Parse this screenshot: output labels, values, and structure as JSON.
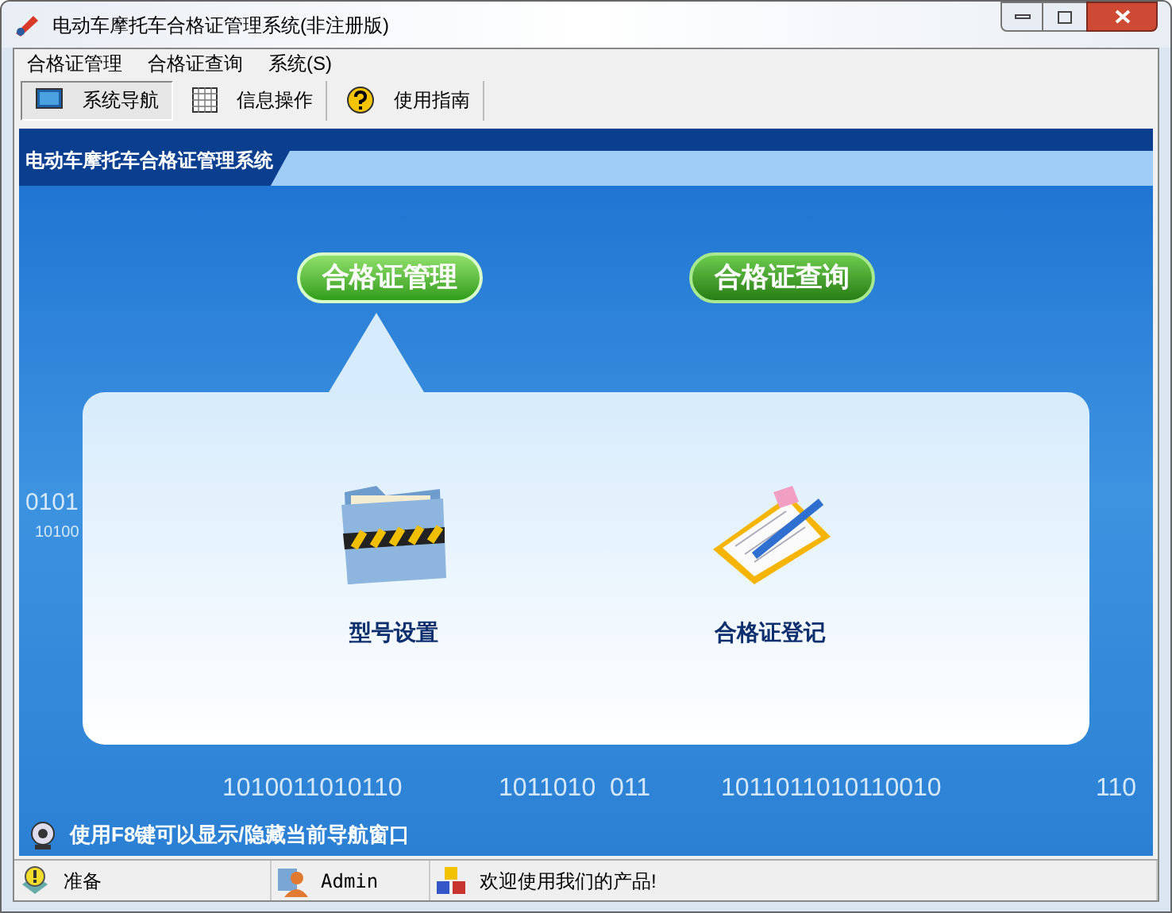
{
  "window": {
    "title": "电动车摩托车合格证管理系统(非注册版)"
  },
  "menu": [
    "合格证管理",
    "合格证查询",
    "系统(S)"
  ],
  "toolbar": [
    {
      "label": "系统导航",
      "kind": "monitor",
      "selected": true
    },
    {
      "label": "信息操作",
      "kind": "grid",
      "selected": false
    },
    {
      "label": "使用指南",
      "kind": "help",
      "selected": false
    }
  ],
  "banner": {
    "title": "电动车摩托车合格证管理系统"
  },
  "nav_tabs": [
    {
      "label": "合格证管理",
      "selected": true
    },
    {
      "label": "合格证查询",
      "selected": false
    }
  ],
  "panel_items": [
    {
      "label": "型号设置",
      "kind": "folder"
    },
    {
      "label": "合格证登记",
      "kind": "clipboard"
    }
  ],
  "background_digits": [
    "0101",
    "10100",
    "1010011010110",
    "1011010  011",
    "1011011010110010",
    "110"
  ],
  "hint": "使用F8键可以显示/隐藏当前导航窗口",
  "status_bar": [
    {
      "text": "准备",
      "kind": "ready"
    },
    {
      "text": "Admin",
      "kind": "user"
    },
    {
      "text": "欢迎使用我们的产品!",
      "kind": "cubes"
    }
  ]
}
